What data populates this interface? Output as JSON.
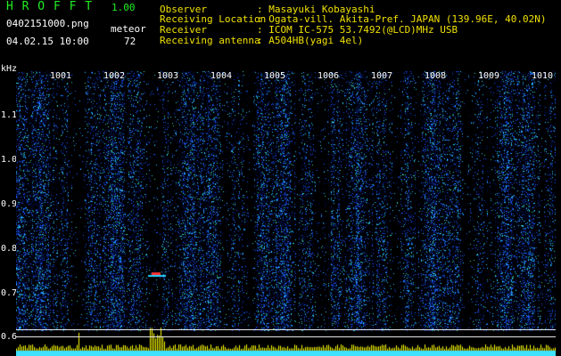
{
  "header": {
    "app_name": "H R O F F T",
    "version": "1.00",
    "filename": "0402151000.png",
    "datetime": "04.02.15 10:00",
    "counter_label": "meteor",
    "counter_value": "72",
    "observer_label": "Observer",
    "observer_value": ": Masayuki Kobayashi",
    "location_label": "Receiving Location",
    "location_value": ": Ogata-vill. Akita-Pref. JAPAN (139.96E, 40.02N)",
    "receiver_label": "Receiver",
    "receiver_value": ": ICOM IC-575 53.7492(@LCD)MHz USB",
    "antenna_label": "Receiving antenna",
    "antenna_value": ": A504HB(yagi 4el)"
  },
  "spectrogram": {
    "y_unit": "kHz",
    "y_ticks": [
      "1.1",
      "1.0",
      "0.9",
      "0.8",
      "0.7",
      "0.6"
    ],
    "time_labels": [
      "1001",
      "1002",
      "1003",
      "1004",
      "1005",
      "1006",
      "1007",
      "1008",
      "1009",
      "1010"
    ],
    "colors": {
      "background": "#000000",
      "noise_dark": "#000a3c",
      "noise_mid": "#1e5aff",
      "noise_bright": "#28d2ff",
      "hot": "#ff3030",
      "level_trace": "#ffff00",
      "level_base": "#40e0ff",
      "markers": "#ffffff"
    }
  }
}
